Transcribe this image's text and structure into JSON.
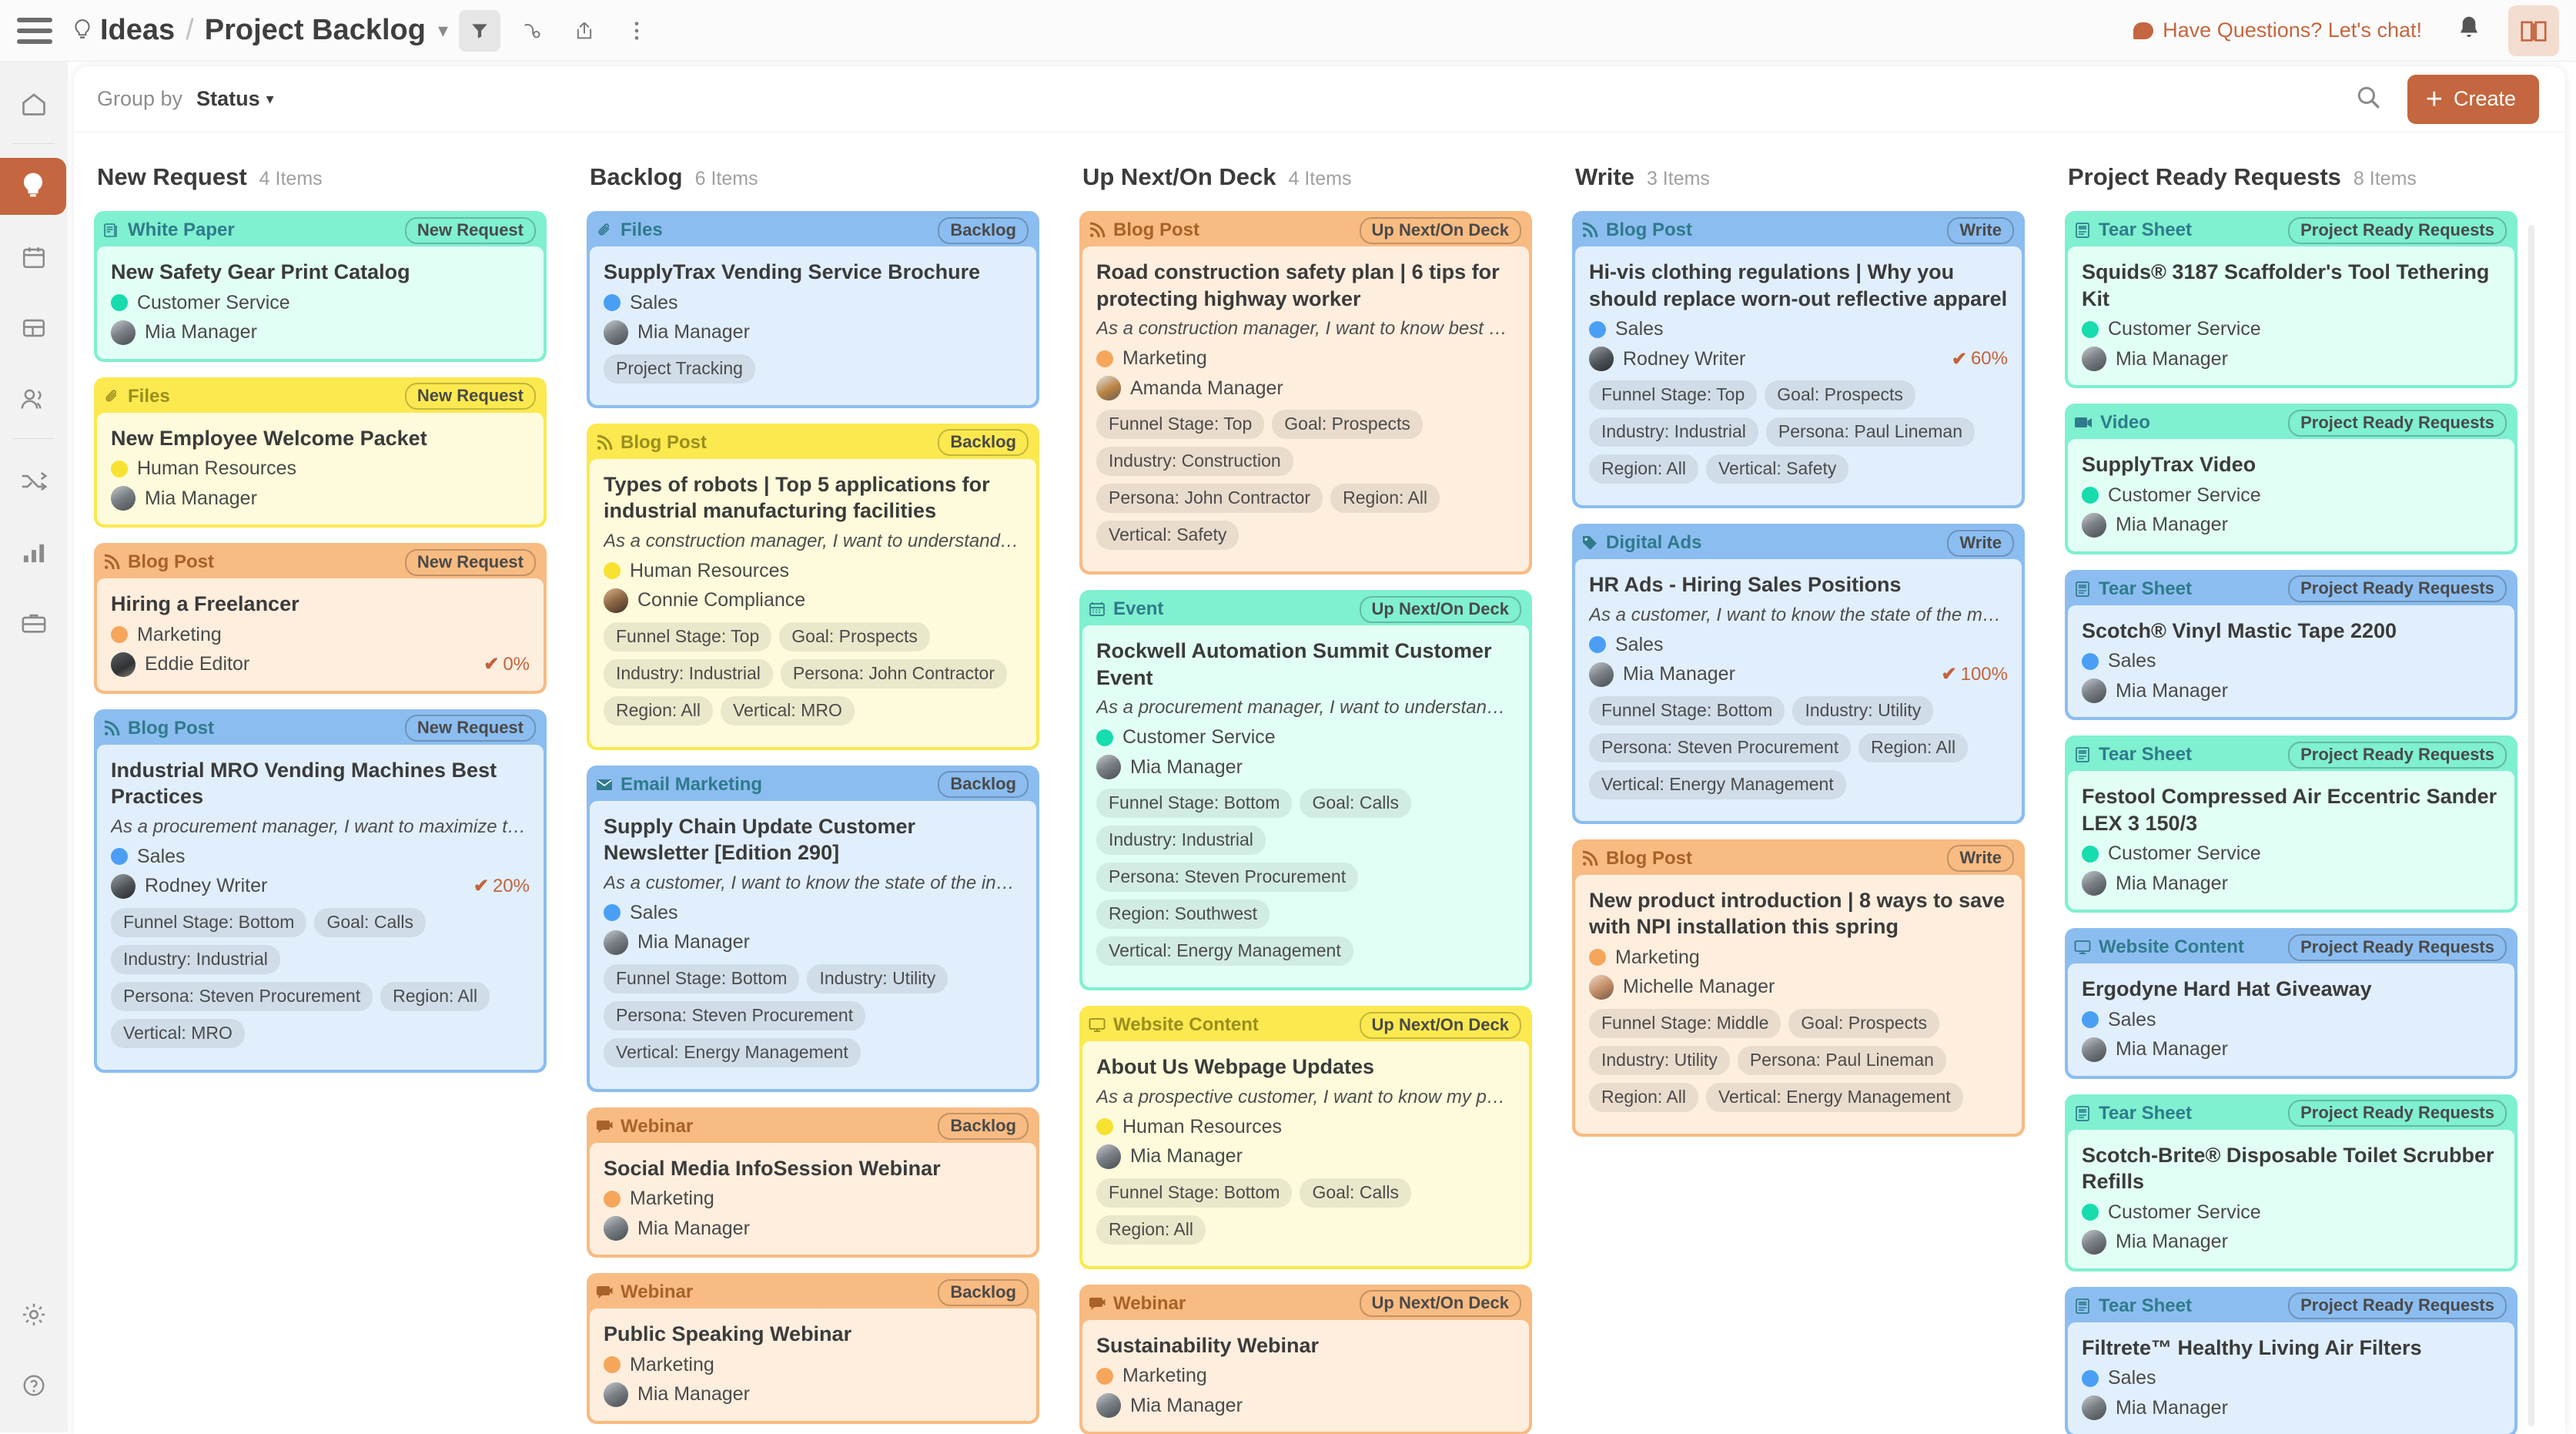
{
  "topbar": {
    "menu_icon": "hamburger-icon",
    "breadcrumb_root": "Ideas",
    "breadcrumb_sep": "/",
    "breadcrumb_current": "Project Backlog",
    "breadcrumb_chevron": "⌄",
    "icons": [
      "filter-icon",
      "automation-icon",
      "share-icon",
      "more-icon"
    ],
    "chat_text": "Have Questions? Let's chat!",
    "bell_icon": "bell-icon",
    "book_icon": "book-icon",
    "accent_color": "#c4663f"
  },
  "rail": {
    "items": [
      {
        "name": "home-icon",
        "selected": false
      },
      {
        "name": "idea-bulb-icon",
        "selected": true
      },
      {
        "name": "calendar-icon",
        "selected": false
      },
      {
        "name": "layout-icon",
        "selected": false
      },
      {
        "name": "people-icon",
        "selected": false
      },
      {
        "name": "shuffle-icon",
        "selected": false
      },
      {
        "name": "analytics-icon",
        "selected": false
      },
      {
        "name": "briefcase-icon",
        "selected": false
      }
    ],
    "bottom": [
      {
        "name": "settings-gear-icon"
      },
      {
        "name": "help-icon"
      }
    ]
  },
  "toolbar": {
    "group_by_label": "Group by",
    "group_by_value": "Status",
    "group_by_chevron": "⌄",
    "search_icon": "search-icon",
    "create_label": "Create",
    "create_plus": "+"
  },
  "team_colors": {
    "Customer Service": "#16dcae",
    "Human Resources": "#f7e231",
    "Marketing": "#f5a65b",
    "Sales": "#4a9ff5"
  },
  "columns": [
    {
      "title": "New Request",
      "count": "4 Items",
      "cards": [
        {
          "type": "White Paper",
          "type_icon": "whitepaper-icon",
          "status": "New Request",
          "theme": {
            "head": "#7ff0d0",
            "body": "#e2fff5",
            "border": "#7ff0d0",
            "type_color": "#2f7b8c"
          },
          "title": "New Safety Gear Print Catalog",
          "desc": "",
          "team": "Customer Service",
          "user": "Mia Manager",
          "avatar": "mia",
          "pct": "",
          "tags": []
        },
        {
          "type": "Files",
          "type_icon": "paperclip-icon",
          "status": "New Request",
          "theme": {
            "head": "#fbe94f",
            "body": "#fdfbdb",
            "border": "#fbe94f",
            "type_color": "#9a8f1e"
          },
          "title": "New Employee Welcome Packet",
          "desc": "",
          "team": "Human Resources",
          "user": "Mia Manager",
          "avatar": "mia",
          "pct": "",
          "tags": []
        },
        {
          "type": "Blog Post",
          "type_icon": "rss-icon",
          "status": "New Request",
          "theme": {
            "head": "#f8bb82",
            "body": "#fdeede",
            "border": "#f8bb82",
            "type_color": "#a86229"
          },
          "title": "Hiring a Freelancer",
          "desc": "",
          "team": "Marketing",
          "user": "Eddie Editor",
          "avatar": "eddie",
          "pct": "0%",
          "tags": []
        },
        {
          "type": "Blog Post",
          "type_icon": "rss-icon",
          "status": "New Request",
          "theme": {
            "head": "#8cbdf0",
            "body": "#e1effc",
            "border": "#8cbdf0",
            "type_color": "#2f7b8c"
          },
          "title": "Industrial MRO Vending Machines Best Practices",
          "desc": "As a procurement manager, I want to maximize the val…",
          "team": "Sales",
          "user": "Rodney Writer",
          "avatar": "rodney",
          "pct": "20%",
          "tags": [
            "Funnel Stage: Bottom",
            "Goal: Calls",
            "Industry: Industrial",
            "Persona: Steven Procurement",
            "Region: All",
            "Vertical: MRO"
          ]
        }
      ]
    },
    {
      "title": "Backlog",
      "count": "6 Items",
      "cards": [
        {
          "type": "Files",
          "type_icon": "paperclip-icon",
          "status": "Backlog",
          "theme": {
            "head": "#8cbdf0",
            "body": "#e1effc",
            "border": "#8cbdf0",
            "type_color": "#2f7b8c"
          },
          "title": "SupplyTrax Vending Service Brochure",
          "desc": "",
          "team": "Sales",
          "user": "Mia Manager",
          "avatar": "mia",
          "pct": "",
          "tags": [
            "Project Tracking"
          ]
        },
        {
          "type": "Blog Post",
          "type_icon": "rss-icon",
          "status": "Backlog",
          "theme": {
            "head": "#fbe94f",
            "body": "#fdfbdb",
            "border": "#fbe94f",
            "type_color": "#9a8f1e"
          },
          "title": "Types of robots | Top 5 applications for industrial manufacturing facilities",
          "desc": "As a construction manager, I want to understand the a…",
          "team": "Human Resources",
          "user": "Connie Compliance",
          "avatar": "connie",
          "pct": "",
          "tags": [
            "Funnel Stage: Top",
            "Goal: Prospects",
            "Industry: Industrial",
            "Persona: John Contractor",
            "Region: All",
            "Vertical: MRO"
          ]
        },
        {
          "type": "Email Marketing",
          "type_icon": "envelope-icon",
          "status": "Backlog",
          "theme": {
            "head": "#8cbdf0",
            "body": "#e1effc",
            "border": "#8cbdf0",
            "type_color": "#2f7b8c"
          },
          "title": "Supply Chain Update Customer Newsletter [Edition 290]",
          "desc": "As a customer, I want to know the state of the industr…",
          "team": "Sales",
          "user": "Mia Manager",
          "avatar": "mia",
          "pct": "",
          "tags": [
            "Funnel Stage: Bottom",
            "Industry: Utility",
            "Persona: Steven Procurement",
            "Vertical: Energy Management"
          ]
        },
        {
          "type": "Webinar",
          "type_icon": "webinar-icon",
          "status": "Backlog",
          "theme": {
            "head": "#f8bb82",
            "body": "#fdeede",
            "border": "#f8bb82",
            "type_color": "#a86229"
          },
          "title": "Social Media InfoSession Webinar",
          "desc": "",
          "team": "Marketing",
          "user": "Mia Manager",
          "avatar": "mia",
          "pct": "",
          "tags": []
        },
        {
          "type": "Webinar",
          "type_icon": "webinar-icon",
          "status": "Backlog",
          "theme": {
            "head": "#f8bb82",
            "body": "#fdeede",
            "border": "#f8bb82",
            "type_color": "#a86229"
          },
          "title": "Public Speaking Webinar",
          "desc": "",
          "team": "Marketing",
          "user": "Mia Manager",
          "avatar": "mia",
          "pct": "",
          "tags": []
        }
      ]
    },
    {
      "title": "Up Next/On Deck",
      "count": "4 Items",
      "cards": [
        {
          "type": "Blog Post",
          "type_icon": "rss-icon",
          "status": "Up Next/On Deck",
          "theme": {
            "head": "#f8bb82",
            "body": "#fdeede",
            "border": "#f8bb82",
            "type_color": "#a86229"
          },
          "title": "Road construction safety plan | 6 tips for protecting highway worker",
          "desc": "As a construction manager, I want to know best practi…",
          "team": "Marketing",
          "user": "Amanda Manager",
          "avatar": "amanda",
          "pct": "",
          "tags": [
            "Funnel Stage: Top",
            "Goal: Prospects",
            "Industry: Construction",
            "Persona: John Contractor",
            "Region: All",
            "Vertical: Safety"
          ]
        },
        {
          "type": "Event",
          "type_icon": "calendar-small-icon",
          "status": "Up Next/On Deck",
          "theme": {
            "head": "#7ff0d0",
            "body": "#e2fff5",
            "border": "#7ff0d0",
            "type_color": "#2f7b8c"
          },
          "title": "Rockwell Automation Summit Customer Event",
          "desc": "As a procurement manager, I want to understand BSE…",
          "team": "Customer Service",
          "user": "Mia Manager",
          "avatar": "mia",
          "pct": "",
          "tags": [
            "Funnel Stage: Bottom",
            "Goal: Calls",
            "Industry: Industrial",
            "Persona: Steven Procurement",
            "Region: Southwest",
            "Vertical: Energy Management"
          ]
        },
        {
          "type": "Website Content",
          "type_icon": "monitor-icon",
          "status": "Up Next/On Deck",
          "theme": {
            "head": "#fbe94f",
            "body": "#fdfbdb",
            "border": "#fbe94f",
            "type_color": "#9a8f1e"
          },
          "title": "About Us Webpage Updates",
          "desc": "As a prospective customer, I want to know my partner…",
          "team": "Human Resources",
          "user": "Mia Manager",
          "avatar": "mia",
          "pct": "",
          "tags": [
            "Funnel Stage: Bottom",
            "Goal: Calls",
            "Region: All"
          ]
        },
        {
          "type": "Webinar",
          "type_icon": "webinar-icon",
          "status": "Up Next/On Deck",
          "theme": {
            "head": "#f8bb82",
            "body": "#fdeede",
            "border": "#f8bb82",
            "type_color": "#a86229"
          },
          "title": "Sustainability Webinar",
          "desc": "",
          "team": "Marketing",
          "user": "Mia Manager",
          "avatar": "mia",
          "pct": "",
          "tags": []
        }
      ]
    },
    {
      "title": "Write",
      "count": "3 Items",
      "cards": [
        {
          "type": "Blog Post",
          "type_icon": "rss-icon",
          "status": "Write",
          "theme": {
            "head": "#8cbdf0",
            "body": "#e1effc",
            "border": "#8cbdf0",
            "type_color": "#2f7b8c"
          },
          "title": "Hi-vis clothing regulations | Why you should replace worn-out reflective apparel",
          "desc": "",
          "team": "Sales",
          "user": "Rodney Writer",
          "avatar": "rodney",
          "pct": "60%",
          "tags": [
            "Funnel Stage: Top",
            "Goal: Prospects",
            "Industry: Industrial",
            "Persona: Paul Lineman",
            "Region: All",
            "Vertical: Safety"
          ]
        },
        {
          "type": "Digital Ads",
          "type_icon": "tag-icon",
          "status": "Write",
          "theme": {
            "head": "#8cbdf0",
            "body": "#e1effc",
            "border": "#8cbdf0",
            "type_color": "#2f7b8c"
          },
          "title": "HR Ads - Hiring Sales Positions",
          "desc": "As a customer, I want to know the state of the market …",
          "team": "Sales",
          "user": "Mia Manager",
          "avatar": "mia",
          "pct": "100%",
          "tags": [
            "Funnel Stage: Bottom",
            "Industry: Utility",
            "Persona: Steven Procurement",
            "Region: All",
            "Vertical: Energy Management"
          ]
        },
        {
          "type": "Blog Post",
          "type_icon": "rss-icon",
          "status": "Write",
          "theme": {
            "head": "#f8bb82",
            "body": "#fdeede",
            "border": "#f8bb82",
            "type_color": "#a86229"
          },
          "title": "New product introduction | 8 ways to save with NPI installation this spring",
          "desc": "",
          "team": "Marketing",
          "user": "Michelle Manager",
          "avatar": "michelle",
          "pct": "",
          "tags": [
            "Funnel Stage: Middle",
            "Goal: Prospects",
            "Industry: Utility",
            "Persona: Paul Lineman",
            "Region: All",
            "Vertical: Energy Management"
          ]
        }
      ]
    },
    {
      "title": "Project Ready Requests",
      "count": "8 Items",
      "cards": [
        {
          "type": "Tear Sheet",
          "type_icon": "tearsheet-icon",
          "status": "Project Ready Requests",
          "theme": {
            "head": "#7ff0d0",
            "body": "#e2fff5",
            "border": "#7ff0d0",
            "type_color": "#2f7b8c"
          },
          "title": "Squids® 3187 Scaffolder's Tool Tethering Kit",
          "desc": "",
          "team": "Customer Service",
          "user": "Mia Manager",
          "avatar": "mia",
          "pct": "",
          "tags": []
        },
        {
          "type": "Video",
          "type_icon": "video-icon",
          "status": "Project Ready Requests",
          "theme": {
            "head": "#7ff0d0",
            "body": "#e2fff5",
            "border": "#7ff0d0",
            "type_color": "#2f7b8c"
          },
          "title": "SupplyTrax Video",
          "desc": "",
          "team": "Customer Service",
          "user": "Mia Manager",
          "avatar": "mia",
          "pct": "",
          "tags": []
        },
        {
          "type": "Tear Sheet",
          "type_icon": "tearsheet-icon",
          "status": "Project Ready Requests",
          "theme": {
            "head": "#8cbdf0",
            "body": "#e1effc",
            "border": "#8cbdf0",
            "type_color": "#2f7b8c"
          },
          "title": "Scotch® Vinyl Mastic Tape 2200",
          "desc": "",
          "team": "Sales",
          "user": "Mia Manager",
          "avatar": "mia",
          "pct": "",
          "tags": []
        },
        {
          "type": "Tear Sheet",
          "type_icon": "tearsheet-icon",
          "status": "Project Ready Requests",
          "theme": {
            "head": "#7ff0d0",
            "body": "#e2fff5",
            "border": "#7ff0d0",
            "type_color": "#2f7b8c"
          },
          "title": "Festool Compressed Air Eccentric Sander LEX 3 150/3",
          "desc": "",
          "team": "Customer Service",
          "user": "Mia Manager",
          "avatar": "mia",
          "pct": "",
          "tags": []
        },
        {
          "type": "Website Content",
          "type_icon": "monitor-icon",
          "status": "Project Ready Requests",
          "theme": {
            "head": "#8cbdf0",
            "body": "#e1effc",
            "border": "#8cbdf0",
            "type_color": "#2f7b8c"
          },
          "title": "Ergodyne Hard Hat Giveaway",
          "desc": "",
          "team": "Sales",
          "user": "Mia Manager",
          "avatar": "mia",
          "pct": "",
          "tags": []
        },
        {
          "type": "Tear Sheet",
          "type_icon": "tearsheet-icon",
          "status": "Project Ready Requests",
          "theme": {
            "head": "#7ff0d0",
            "body": "#e2fff5",
            "border": "#7ff0d0",
            "type_color": "#2f7b8c"
          },
          "title": "Scotch-Brite® Disposable Toilet Scrubber Refills",
          "desc": "",
          "team": "Customer Service",
          "user": "Mia Manager",
          "avatar": "mia",
          "pct": "",
          "tags": []
        },
        {
          "type": "Tear Sheet",
          "type_icon": "tearsheet-icon",
          "status": "Project Ready Requests",
          "theme": {
            "head": "#8cbdf0",
            "body": "#e1effc",
            "border": "#8cbdf0",
            "type_color": "#2f7b8c"
          },
          "title": "Filtrete™ Healthy Living Air Filters",
          "desc": "",
          "team": "Sales",
          "user": "Mia Manager",
          "avatar": "mia",
          "pct": "",
          "tags": []
        }
      ]
    }
  ]
}
